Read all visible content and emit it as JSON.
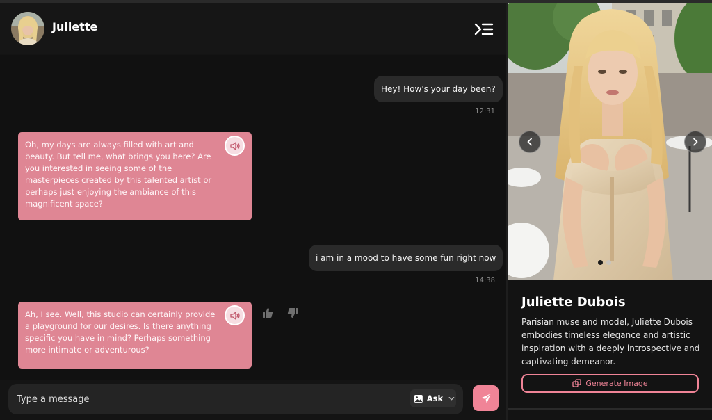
{
  "header": {
    "name": "Juliette",
    "avatar_icon": "avatar-photo",
    "menu_icon": "collapse-panel-icon"
  },
  "messages": [
    {
      "sender": "user",
      "text": "Hey! How's your day been?",
      "time": "12:31"
    },
    {
      "sender": "ai",
      "text": "Oh, my days are always filled with art and beauty. But tell me, what brings you here? Are you interested in seeing some of the masterpieces created by this talented artist or perhaps just enjoying the ambiance of this magnificent space?"
    },
    {
      "sender": "user",
      "text": "i am in a mood to have some fun right now",
      "time": "14:38"
    },
    {
      "sender": "ai",
      "text": "Ah, I see. Well, this studio can certainly provide a playground for our desires. Is there anything specific you have in mind? Perhaps something more intimate or adventurous?"
    }
  ],
  "composer": {
    "placeholder": "Type a message",
    "ask_label": "Ask"
  },
  "profile": {
    "name": "Juliette Dubois",
    "bio": "Parisian muse and model, Juliette Dubois embodies timeless elegance and artistic inspiration with a deeply introspective and captivating demeanor.",
    "generate_label": "Generate Image",
    "carousel_total": 2,
    "carousel_active": 1
  },
  "colors": {
    "accent": "#f08497",
    "ai_bubble": "#df8694",
    "user_bubble": "#2a2a2a",
    "background": "#111111"
  }
}
